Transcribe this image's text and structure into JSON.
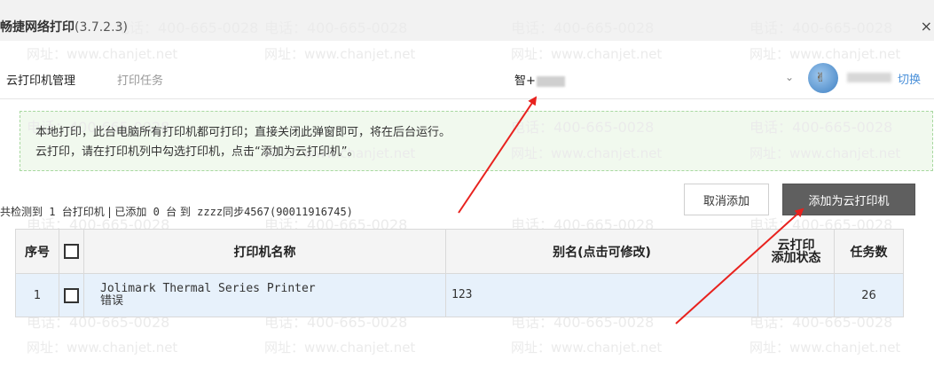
{
  "window": {
    "title": "畅捷网络打印",
    "version": "(3.7.2.3)",
    "close_icon": "×"
  },
  "nav": {
    "tabs": [
      {
        "label": "云打印机管理",
        "active": true
      },
      {
        "label": "打印任务",
        "active": false
      }
    ],
    "company": "智+",
    "switch_label": "切换"
  },
  "notice": {
    "line1": "本地打印，此台电脑所有打印机都可打印；直接关闭此弹窗即可，将在后台运行。",
    "line2": "云打印，请在打印机列中勾选打印机，点击“添加为云打印机”。"
  },
  "summary": {
    "part1": "共检测到",
    "detected": "1",
    "part2": "台打印机 | 已添加",
    "added": "0",
    "part3": "台 到",
    "target": "zzzz同步4567(90011916745)"
  },
  "buttons": {
    "cancel": "取消添加",
    "add": "添加为云打印机"
  },
  "table": {
    "headers": {
      "seq": "序号",
      "name": "打印机名称",
      "alias": "别名(点击可修改)",
      "status_line1": "云打印",
      "status_line2": "添加状态",
      "tasks": "任务数"
    },
    "rows": [
      {
        "seq": "1",
        "name": "Jolimark Thermal Series Printer",
        "name_sub": "错误",
        "alias": "123",
        "status": "",
        "tasks": "26"
      }
    ]
  },
  "watermark": {
    "phone": "电话：400-665-0028",
    "site": "网址：www.chanjet.net"
  },
  "colors": {
    "accent_red": "#e8221e",
    "link_blue": "#4a90d9",
    "primary_button": "#5f5f5f",
    "row_highlight": "#e7f1fb",
    "notice_bg": "#f1f9ee"
  }
}
